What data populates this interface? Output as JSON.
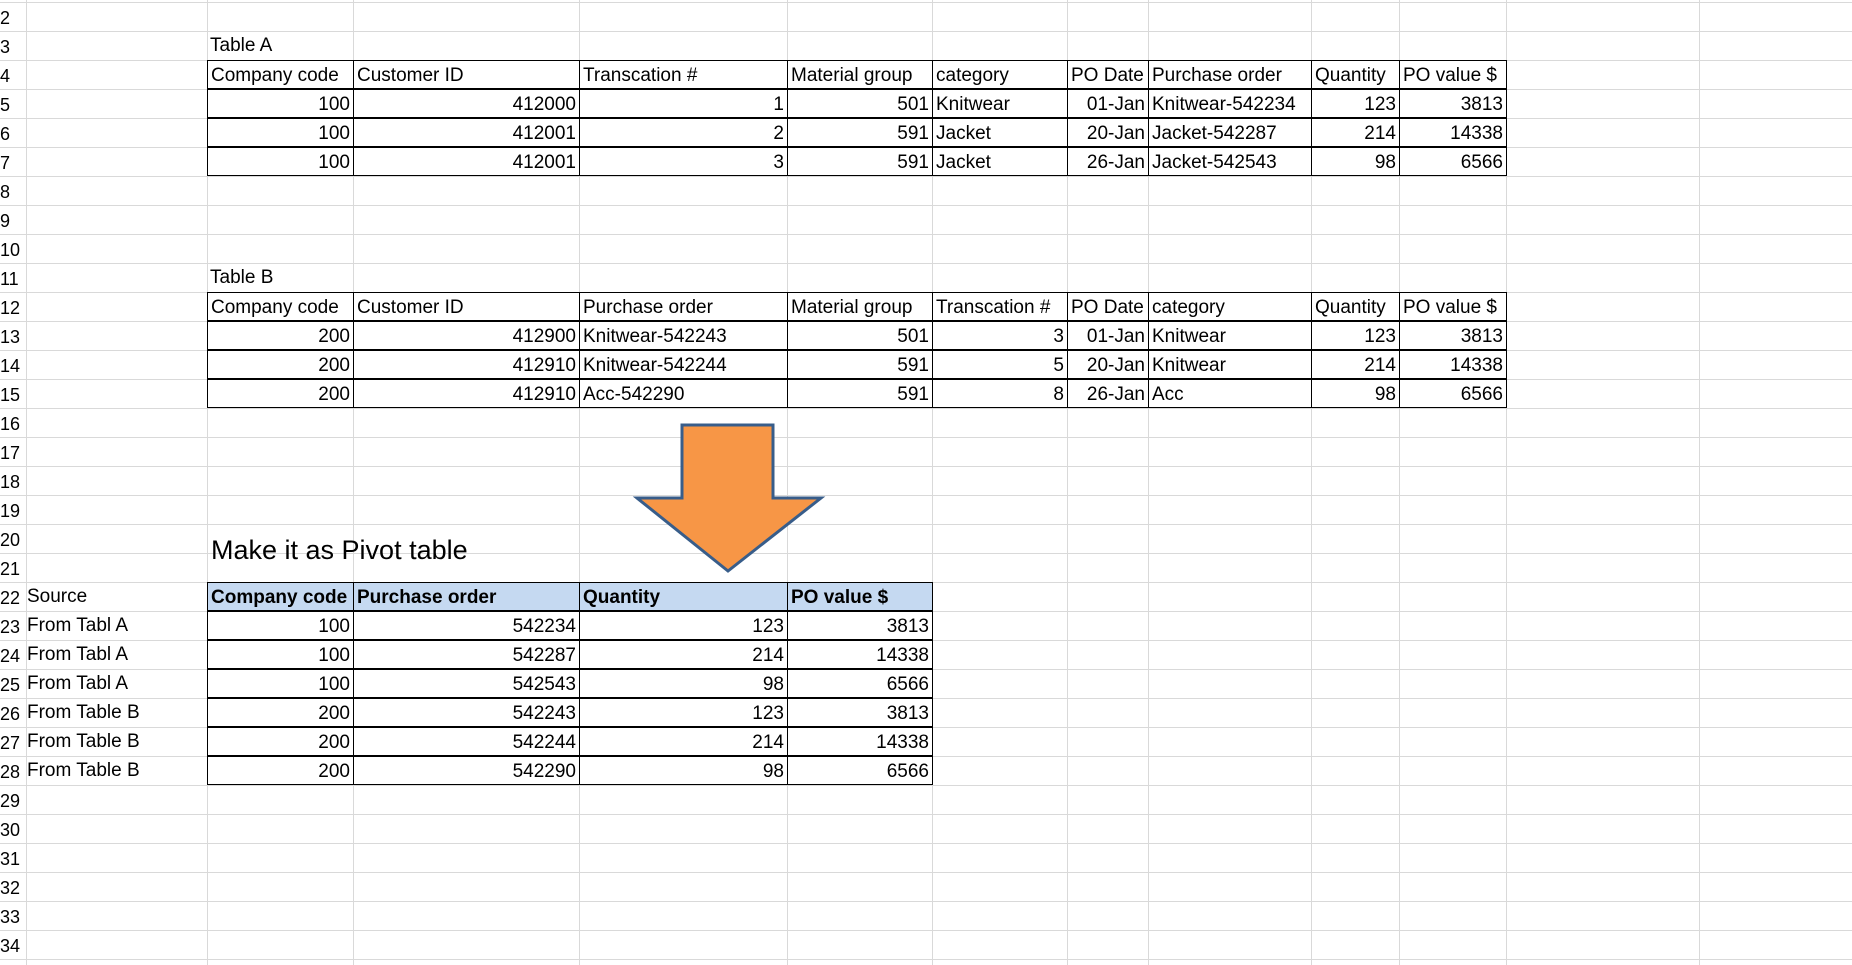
{
  "rows": {
    "numbers": [
      "2",
      "3",
      "4",
      "5",
      "6",
      "7",
      "8",
      "9",
      "10",
      "11",
      "12",
      "13",
      "14",
      "15",
      "16",
      "17",
      "18",
      "19",
      "20",
      "21",
      "22",
      "23",
      "24",
      "25",
      "26",
      "27",
      "28",
      "29",
      "30",
      "31",
      "32",
      "33",
      "34"
    ]
  },
  "table_a": {
    "title": "Table A",
    "headers": [
      "Company code",
      "Customer ID",
      "Transcation #",
      "Material group",
      "category",
      "PO Date",
      "Purchase order",
      "Quantity",
      "PO value $"
    ],
    "rows": [
      [
        "100",
        "412000",
        "1",
        "501",
        "Knitwear",
        "01-Jan",
        "Knitwear-542234",
        "123",
        "3813"
      ],
      [
        "100",
        "412001",
        "2",
        "591",
        "Jacket",
        "20-Jan",
        "Jacket-542287",
        "214",
        "14338"
      ],
      [
        "100",
        "412001",
        "3",
        "591",
        "Jacket",
        "26-Jan",
        "Jacket-542543",
        "98",
        "6566"
      ]
    ]
  },
  "table_b": {
    "title": "Table B",
    "headers": [
      "Company code",
      "Customer ID",
      "Purchase order",
      "Material group",
      "Transcation #",
      "PO Date",
      "category",
      "Quantity",
      "PO value $"
    ],
    "rows": [
      [
        "200",
        "412900",
        "Knitwear-542243",
        "501",
        "3",
        "01-Jan",
        "Knitwear",
        "123",
        "3813"
      ],
      [
        "200",
        "412910",
        "Knitwear-542244",
        "591",
        "5",
        "20-Jan",
        "Knitwear",
        "214",
        "14338"
      ],
      [
        "200",
        "412910",
        "Acc-542290",
        "591",
        "8",
        "26-Jan",
        "Acc",
        "98",
        "6566"
      ]
    ]
  },
  "instruction": "Make it as  Pivot table",
  "pivot": {
    "source_header": "Source",
    "headers": [
      "Company code",
      "Purchase order",
      "Quantity",
      "PO value $"
    ],
    "rows": [
      {
        "source": "From Tabl A",
        "values": [
          "100",
          "542234",
          "123",
          "3813"
        ]
      },
      {
        "source": "From Tabl A",
        "values": [
          "100",
          "542287",
          "214",
          "14338"
        ]
      },
      {
        "source": "From Tabl A",
        "values": [
          "100",
          "542543",
          "98",
          "6566"
        ]
      },
      {
        "source": "From Table B",
        "values": [
          "200",
          "542243",
          "123",
          "3813"
        ]
      },
      {
        "source": "From Table B",
        "values": [
          "200",
          "542244",
          "214",
          "14338"
        ]
      },
      {
        "source": "From Table B",
        "values": [
          "200",
          "542290",
          "98",
          "6566"
        ]
      }
    ]
  },
  "colors": {
    "gridline": "#d9d9d9",
    "header_fill": "#c5d9f1",
    "arrow_fill": "#f79646",
    "arrow_stroke": "#385d8a"
  },
  "shapes": {
    "arrow": "down-arrow-shape"
  }
}
